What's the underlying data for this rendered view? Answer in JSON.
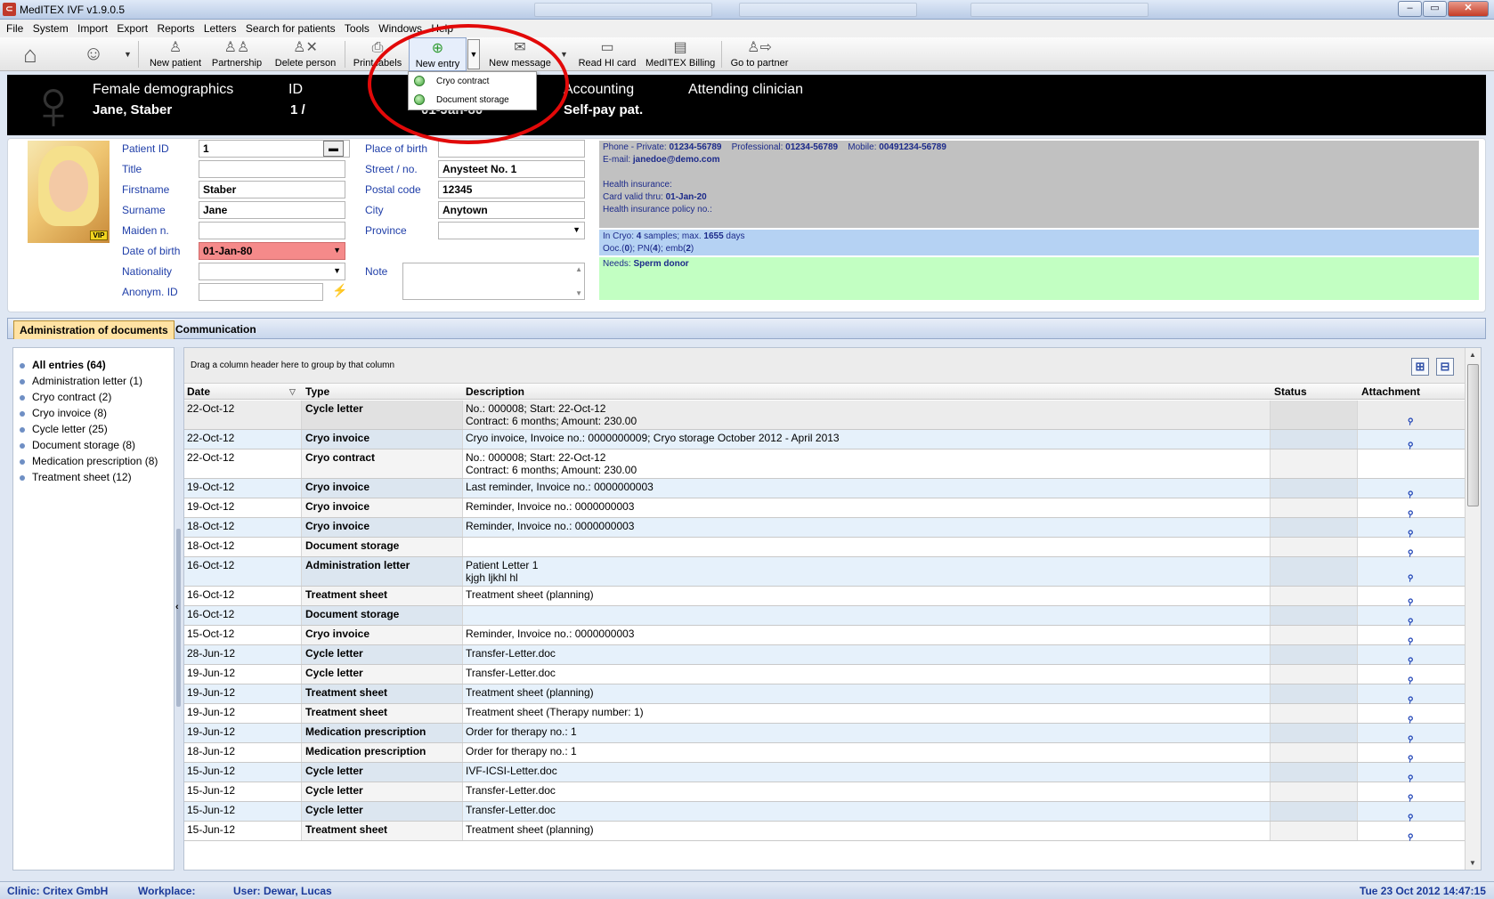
{
  "window": {
    "title": "MedITEX IVF v1.9.0.5",
    "app_icon": "meditex-logo-icon",
    "controls": {
      "minimize": "–",
      "maximize": "▭",
      "close": "✕"
    }
  },
  "menu": [
    "File",
    "System",
    "Import",
    "Export",
    "Reports",
    "Letters",
    "Search for patients",
    "Tools",
    "Windows",
    "Help"
  ],
  "toolbar": {
    "new_patient": "New patient",
    "partnership": "Partnership",
    "delete_person": "Delete person",
    "print_labels": "Print labels",
    "new_entry": "New entry",
    "new_message": "New message",
    "read_hi_card": "Read HI card",
    "meditex_billing": "MedITEX Billing",
    "go_to_partner": "Go to partner"
  },
  "new_entry_menu": [
    "Cryo contract",
    "Document storage"
  ],
  "header": {
    "demographics_label": "Female demographics",
    "patient_name": "Jane, Staber",
    "id_label": "ID",
    "id_value": "1 /",
    "dob_value": "01-Jan-80",
    "accounting_label": "Accounting",
    "accounting_value": "Self-pay pat.",
    "clinician_label": "Attending clinician",
    "clinician_value": ""
  },
  "demographics": {
    "patient_id_label": "Patient ID",
    "patient_id": "1",
    "title_label": "Title",
    "title": "",
    "firstname_label": "Firstname",
    "firstname": "Staber",
    "surname_label": "Surname",
    "surname": "Jane",
    "maiden_label": "Maiden n.",
    "maiden": "",
    "dob_label": "Date of birth",
    "dob": "01-Jan-80",
    "nationality_label": "Nationality",
    "nationality": "",
    "anonym_label": "Anonym. ID",
    "anonym": "",
    "place_of_birth_label": "Place of birth",
    "place_of_birth": "",
    "street_label": "Street / no.",
    "street": "Anysteet No. 1",
    "postal_label": "Postal code",
    "postal": "12345",
    "city_label": "City",
    "city": "Anytown",
    "province_label": "Province",
    "province": "",
    "note_label": "Note",
    "note": "",
    "vip_badge": "VIP"
  },
  "contact": {
    "phone_private_label": "Phone - Private:",
    "phone_private": "01234-56789",
    "phone_professional_label": "Professional:",
    "phone_professional": "01234-56789",
    "mobile_label": "Mobile:",
    "mobile": "00491234-56789",
    "email_label": "E-mail:",
    "email": "janedoe@demo.com",
    "health_insurance_label": "Health insurance:",
    "card_valid_label": "Card valid thru:",
    "card_valid": "01-Jan-20",
    "policy_label": "Health insurance policy no.:"
  },
  "cryo": {
    "line1_prefix": "In Cryo:",
    "samples": "4",
    "line1_mid": "samples; max.",
    "days": "1655",
    "line1_suffix": "days",
    "line2_a": "Ooc.(",
    "ooc": "0",
    "line2_b": "); PN(",
    "pn": "4",
    "line2_c": "); emb(",
    "emb": "2",
    "line2_d": ")"
  },
  "needs": {
    "label": "Needs:",
    "value": "Sperm donor"
  },
  "tabs": [
    "Administration of documents",
    "Communication"
  ],
  "categories": [
    "All entries (64)",
    "Administration letter (1)",
    "Cryo contract (2)",
    "Cryo invoice (8)",
    "Cycle letter (25)",
    "Document storage (8)",
    "Medication prescription (8)",
    "Treatment sheet (12)"
  ],
  "grid": {
    "group_hint": "Drag a column header here to group by that column",
    "columns": {
      "date": "Date",
      "type": "Type",
      "description": "Description",
      "status": "Status",
      "attachment": "Attachment"
    },
    "rows": [
      {
        "date": "22-Oct-12",
        "type": "Cycle letter",
        "desc": [
          "No.: 000008; Start: 22-Oct-12",
          "Contract: 6 months; Amount: 230.00"
        ],
        "attachment": true
      },
      {
        "date": "22-Oct-12",
        "type": "Cryo invoice",
        "desc": [
          "Cryo invoice, Invoice no.: 0000000009; Cryo storage October 2012 - April 2013"
        ],
        "attachment": true
      },
      {
        "date": "22-Oct-12",
        "type": "Cryo contract",
        "desc": [
          "No.: 000008; Start: 22-Oct-12",
          "Contract: 6 months; Amount: 230.00"
        ],
        "attachment": false
      },
      {
        "date": "19-Oct-12",
        "type": "Cryo invoice",
        "desc": [
          "Last reminder, Invoice no.: 0000000003"
        ],
        "attachment": true
      },
      {
        "date": "19-Oct-12",
        "type": "Cryo invoice",
        "desc": [
          "Reminder, Invoice no.: 0000000003"
        ],
        "attachment": true
      },
      {
        "date": "18-Oct-12",
        "type": "Cryo invoice",
        "desc": [
          "Reminder, Invoice no.: 0000000003"
        ],
        "attachment": true
      },
      {
        "date": "18-Oct-12",
        "type": "Document storage",
        "desc": [
          ""
        ],
        "attachment": true
      },
      {
        "date": "16-Oct-12",
        "type": "Administration letter",
        "desc": [
          "Patient Letter 1",
          "kjgh ljkhl hl"
        ],
        "attachment": true
      },
      {
        "date": "16-Oct-12",
        "type": "Treatment sheet",
        "desc": [
          "Treatment sheet (planning)"
        ],
        "attachment": true
      },
      {
        "date": "16-Oct-12",
        "type": "Document storage",
        "desc": [
          ""
        ],
        "attachment": true
      },
      {
        "date": "15-Oct-12",
        "type": "Cryo invoice",
        "desc": [
          "Reminder, Invoice no.: 0000000003"
        ],
        "attachment": true
      },
      {
        "date": "28-Jun-12",
        "type": "Cycle letter",
        "desc": [
          "Transfer-Letter.doc"
        ],
        "attachment": true
      },
      {
        "date": "19-Jun-12",
        "type": "Cycle letter",
        "desc": [
          "Transfer-Letter.doc"
        ],
        "attachment": true
      },
      {
        "date": "19-Jun-12",
        "type": "Treatment sheet",
        "desc": [
          "Treatment sheet (planning)"
        ],
        "attachment": true
      },
      {
        "date": "19-Jun-12",
        "type": "Treatment sheet",
        "desc": [
          "Treatment sheet  (Therapy number:  1)"
        ],
        "attachment": true
      },
      {
        "date": "19-Jun-12",
        "type": "Medication prescription",
        "desc": [
          "Order for therapy no.: 1"
        ],
        "attachment": true
      },
      {
        "date": "18-Jun-12",
        "type": "Medication prescription",
        "desc": [
          "Order for therapy no.: 1"
        ],
        "attachment": true
      },
      {
        "date": "15-Jun-12",
        "type": "Cycle letter",
        "desc": [
          "IVF-ICSI-Letter.doc"
        ],
        "attachment": true
      },
      {
        "date": "15-Jun-12",
        "type": "Cycle letter",
        "desc": [
          "Transfer-Letter.doc"
        ],
        "attachment": true
      },
      {
        "date": "15-Jun-12",
        "type": "Cycle letter",
        "desc": [
          "Transfer-Letter.doc"
        ],
        "attachment": true
      },
      {
        "date": "15-Jun-12",
        "type": "Treatment sheet",
        "desc": [
          "Treatment sheet (planning)"
        ],
        "attachment": true
      }
    ]
  },
  "status": {
    "clinic": "Clinic: Critex GmbH",
    "workplace": "Workplace:",
    "user": "User: Dewar, Lucas",
    "datetime": "Tue 23 Oct 2012 14:47:15"
  },
  "colors": {
    "accent": "#1f3ea8",
    "annotation": "#e20909",
    "required_field": "#f58a8a",
    "needs_box": "#c2ffc2",
    "cryo_box": "#b5d2f3",
    "contact_box": "#c1c1c1"
  }
}
